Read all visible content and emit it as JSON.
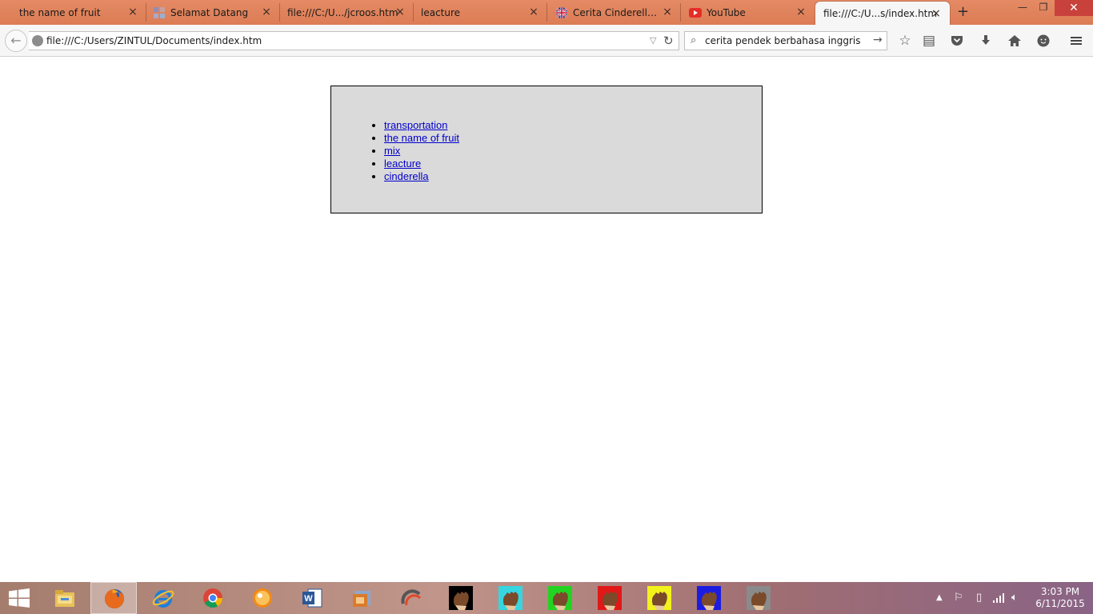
{
  "tabs": [
    {
      "label": "the name of fruit"
    },
    {
      "label": "Selamat Datang"
    },
    {
      "label": "file:///C:/U.../jcroos.htm"
    },
    {
      "label": "leacture"
    },
    {
      "label": "Cerita Cinderella d..."
    },
    {
      "label": "YouTube"
    },
    {
      "label": "file:///C:/U...s/index.htm"
    }
  ],
  "nav": {
    "url": "file:///C:/Users/ZINTUL/Documents/index.htm",
    "search_value": "cerita pendek berbahasa inggris"
  },
  "page": {
    "links": [
      {
        "label": "transportation"
      },
      {
        "label": "the name of fruit"
      },
      {
        "label": "mix"
      },
      {
        "label": "leacture"
      },
      {
        "label": "cinderella"
      }
    ]
  },
  "taskbar": {
    "clock_time": "3:03 PM",
    "clock_date": "6/11/2015",
    "apps": [
      {
        "icon": "file-explorer-icon"
      },
      {
        "icon": "firefox-icon"
      },
      {
        "icon": "internet-explorer-icon"
      },
      {
        "icon": "chrome-icon"
      },
      {
        "icon": "media-player-icon"
      },
      {
        "icon": "word-icon"
      },
      {
        "icon": "app-icon"
      },
      {
        "icon": "app-icon"
      },
      {
        "icon": "hand-black-icon"
      },
      {
        "icon": "hand-cyan-icon"
      },
      {
        "icon": "hand-green-icon"
      },
      {
        "icon": "hand-red-icon"
      },
      {
        "icon": "hand-yellow-icon"
      },
      {
        "icon": "hand-blue-icon"
      },
      {
        "icon": "hand-gray-icon"
      }
    ]
  },
  "colors": {
    "tabbar": "#e0825c",
    "link": "#0000cc",
    "box_bg": "#dadada",
    "close_button": "#c9413b"
  }
}
